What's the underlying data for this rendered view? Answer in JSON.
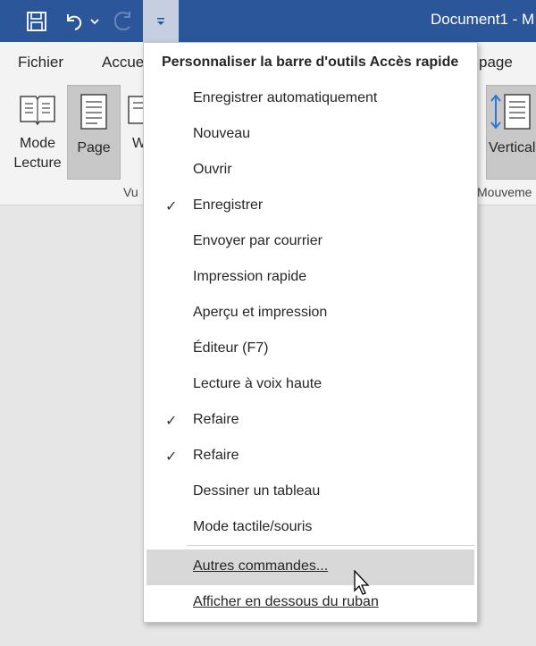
{
  "window": {
    "title": "Document1 - M"
  },
  "qat": {
    "save_icon": "save-icon",
    "undo_icon": "undo-icon",
    "redo_icon": "redo-icon",
    "customize_icon": "customize-qat-icon"
  },
  "tabs": {
    "file": "Fichier",
    "home": "Accue",
    "layout_partial": "page"
  },
  "ribbon": {
    "reading_mode": "Mode Lecture",
    "page": "Page",
    "web_partial": "W",
    "vertical": "Vertical",
    "group_views": "Vu",
    "group_movement": "Mouveme"
  },
  "menu": {
    "header": "Personnaliser la barre d'outils Accès rapide",
    "items": [
      {
        "label": "Enregistrer automatiquement",
        "check": ""
      },
      {
        "label": "Nouveau",
        "check": ""
      },
      {
        "label": "Ouvrir",
        "check": ""
      },
      {
        "label": "Enregistrer",
        "check": "✓"
      },
      {
        "label": "Envoyer par courrier",
        "check": ""
      },
      {
        "label": "Impression rapide",
        "check": ""
      },
      {
        "label": "Aperçu et impression",
        "check": ""
      },
      {
        "label": "Éditeur (F7)",
        "check": ""
      },
      {
        "label": "Lecture à voix haute",
        "check": ""
      },
      {
        "label": "Refaire",
        "check": "✓"
      },
      {
        "label": "Refaire",
        "check": "✓"
      },
      {
        "label": "Dessiner un tableau",
        "check": ""
      },
      {
        "label": "Mode tactile/souris",
        "check": ""
      }
    ],
    "more_commands": "Autres commandes...",
    "show_below": "Afficher en dessous du ruban"
  },
  "colors": {
    "titlebar": "#2b579a",
    "ribbon": "#f3f3f3",
    "hover": "#d8d8d8"
  }
}
